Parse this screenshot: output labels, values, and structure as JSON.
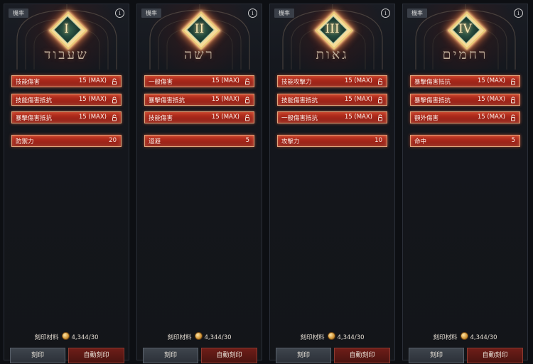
{
  "panels": [
    {
      "prob_tag": "機率",
      "info": "i",
      "numeral": "I",
      "rune_text": "שעבוד",
      "stats": [
        {
          "label": "技能傷害",
          "value": "15 (MAX)"
        },
        {
          "label": "技能傷害抵抗",
          "value": "15 (MAX)"
        },
        {
          "label": "暴擊傷害抵抗",
          "value": "15 (MAX)"
        }
      ],
      "bonus": {
        "label": "防禦力",
        "value": "20"
      },
      "material_label": "刻印材料",
      "material_count": "4,344/30",
      "engrave_label": "刻印",
      "auto_label": "自動刻印"
    },
    {
      "prob_tag": "機率",
      "info": "i",
      "numeral": "II",
      "rune_text": "רשה",
      "stats": [
        {
          "label": "一般傷害",
          "value": "15 (MAX)"
        },
        {
          "label": "暴擊傷害抵抗",
          "value": "15 (MAX)"
        },
        {
          "label": "技能傷害",
          "value": "15 (MAX)"
        }
      ],
      "bonus": {
        "label": "迴避",
        "value": "5"
      },
      "material_label": "刻印材料",
      "material_count": "4,344/30",
      "engrave_label": "刻印",
      "auto_label": "自動刻印"
    },
    {
      "prob_tag": "機率",
      "info": "i",
      "numeral": "III",
      "rune_text": "גאות",
      "stats": [
        {
          "label": "技能攻擊力",
          "value": "15 (MAX)"
        },
        {
          "label": "技能傷害抵抗",
          "value": "15 (MAX)"
        },
        {
          "label": "一般傷害抵抗",
          "value": "15 (MAX)"
        }
      ],
      "bonus": {
        "label": "攻擊力",
        "value": "10"
      },
      "material_label": "刻印材料",
      "material_count": "4,344/30",
      "engrave_label": "刻印",
      "auto_label": "自動刻印"
    },
    {
      "prob_tag": "機率",
      "info": "i",
      "numeral": "IV",
      "rune_text": "רחמים",
      "stats": [
        {
          "label": "暴擊傷害抵抗",
          "value": "15 (MAX)"
        },
        {
          "label": "暴擊傷害抵抗",
          "value": "15 (MAX)"
        },
        {
          "label": "額外傷害",
          "value": "15 (MAX)"
        }
      ],
      "bonus": {
        "label": "命中",
        "value": "5"
      },
      "material_label": "刻印材料",
      "material_count": "4,344/30",
      "engrave_label": "刻印",
      "auto_label": "自動刻印"
    }
  ],
  "colors": {
    "stat_fill": "#a4261a",
    "stat_border": "#e0a37a",
    "emblem_gold": "#f6dc9b",
    "emblem_green": "#2f5a47"
  },
  "icons": {
    "lock": "lock-icon",
    "coin": "coin-icon",
    "info": "info-icon"
  }
}
